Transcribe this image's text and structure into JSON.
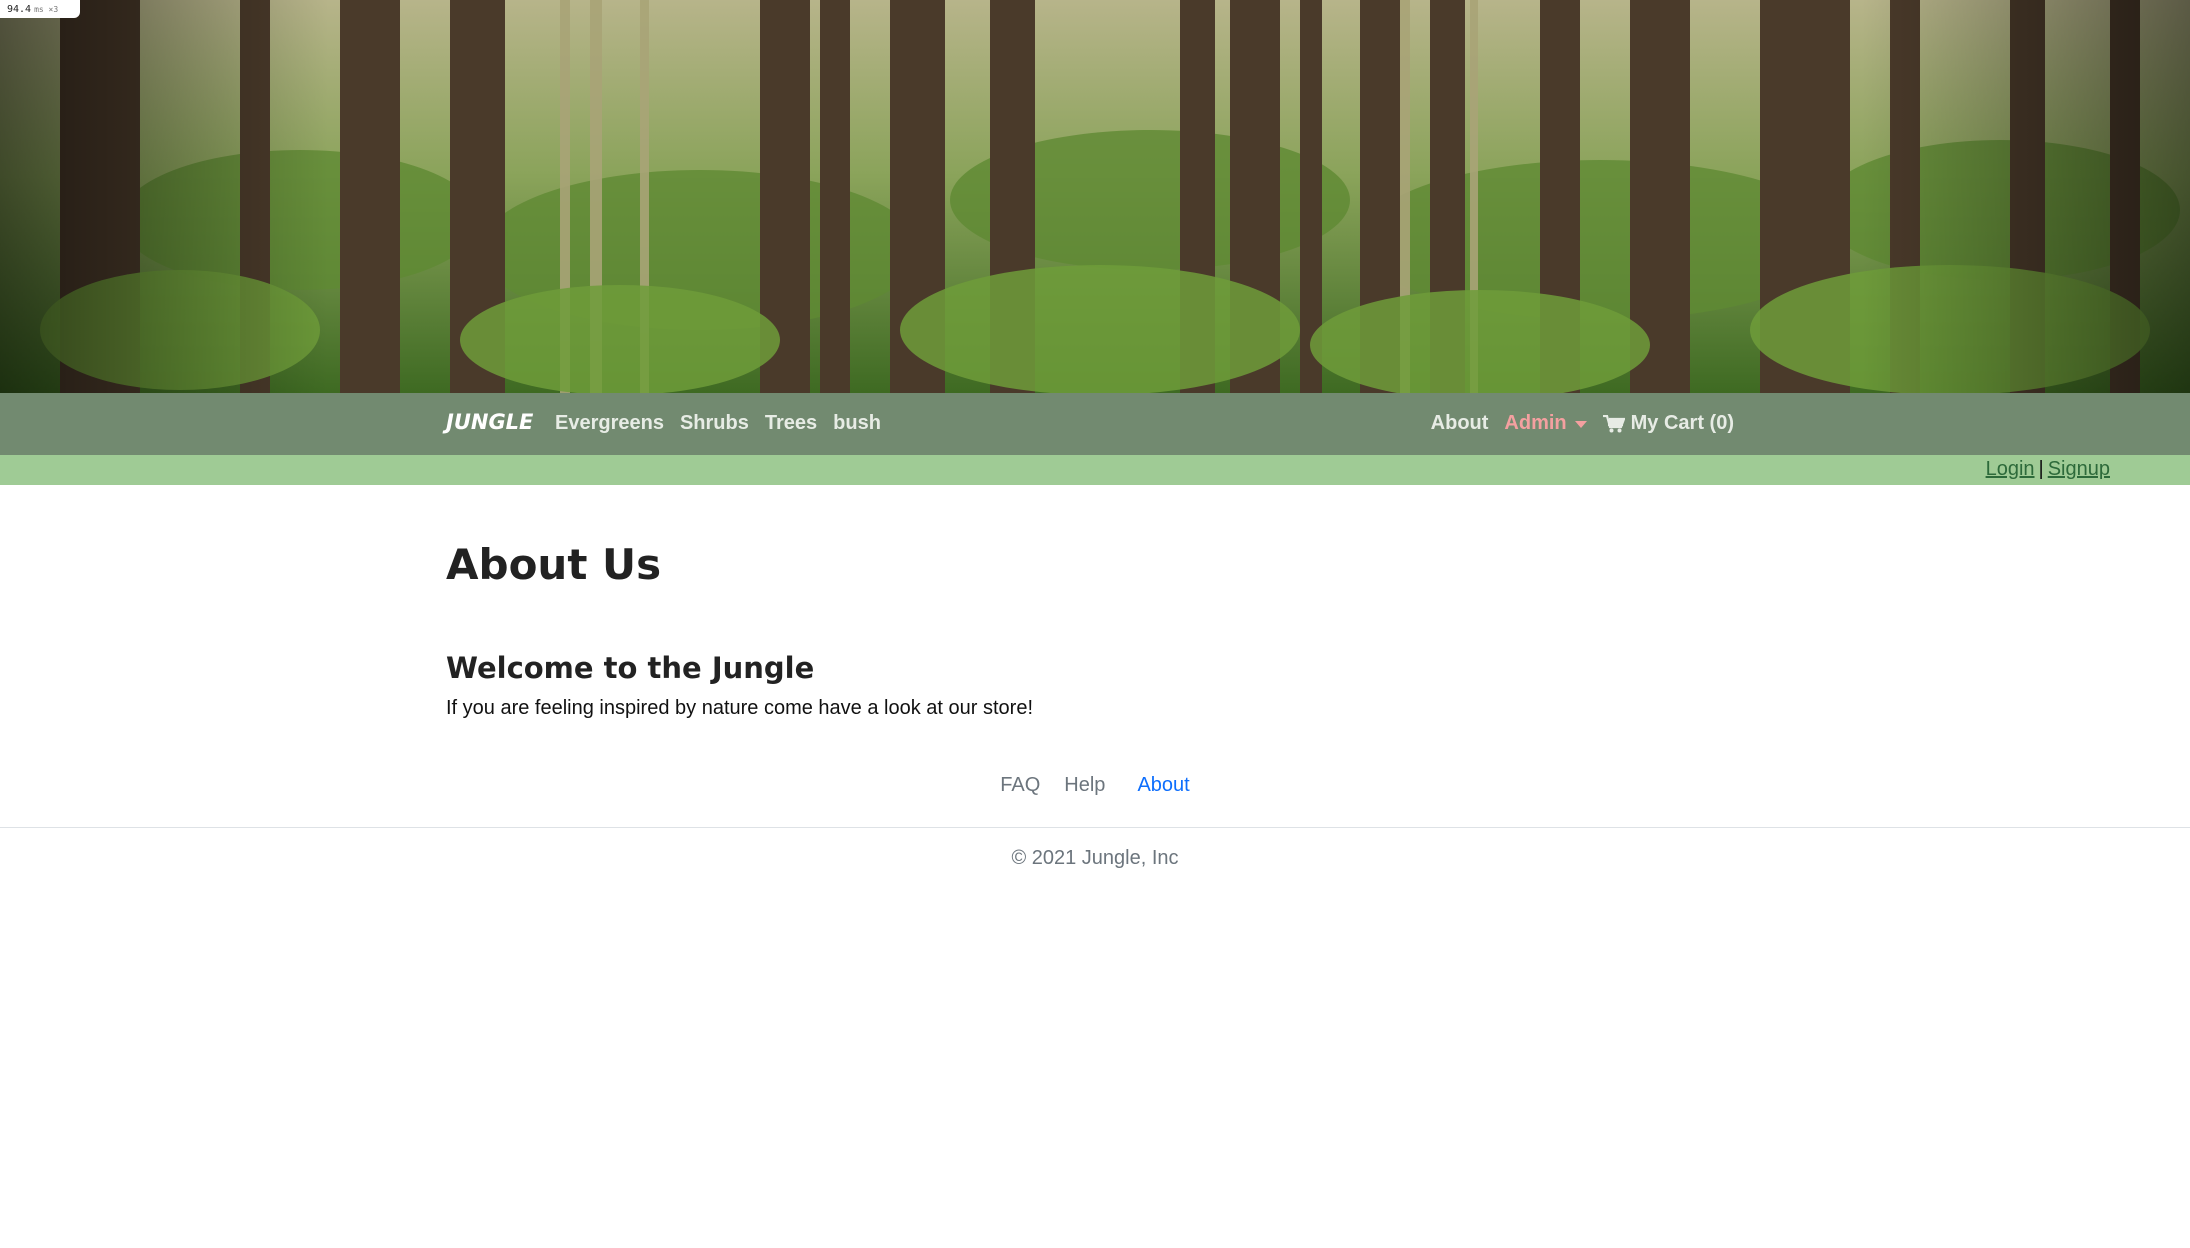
{
  "perf": {
    "value": "94.4",
    "unit": "ms ×3"
  },
  "hero": {
    "image": "forest-banner"
  },
  "navbar": {
    "brand": "JUNGLE",
    "categories": [
      "Evergreens",
      "Shrubs",
      "Trees",
      "bush"
    ],
    "about": "About",
    "admin": "Admin",
    "cart": "My Cart (0)"
  },
  "auth": {
    "login": "Login",
    "separator": "|",
    "signup": "Signup"
  },
  "main": {
    "title": "About Us",
    "subtitle": "Welcome to the Jungle",
    "intro": "If you are feeling inspired by nature come have a look at our store!"
  },
  "footer": {
    "links": [
      "FAQ",
      "Help",
      "About"
    ],
    "copyright": "© 2021 Jungle, Inc"
  },
  "colors": {
    "navbar": "#728a70",
    "authbar": "#9fcb95",
    "admin": "#f4a0a0",
    "active_link": "#0d6efd"
  }
}
